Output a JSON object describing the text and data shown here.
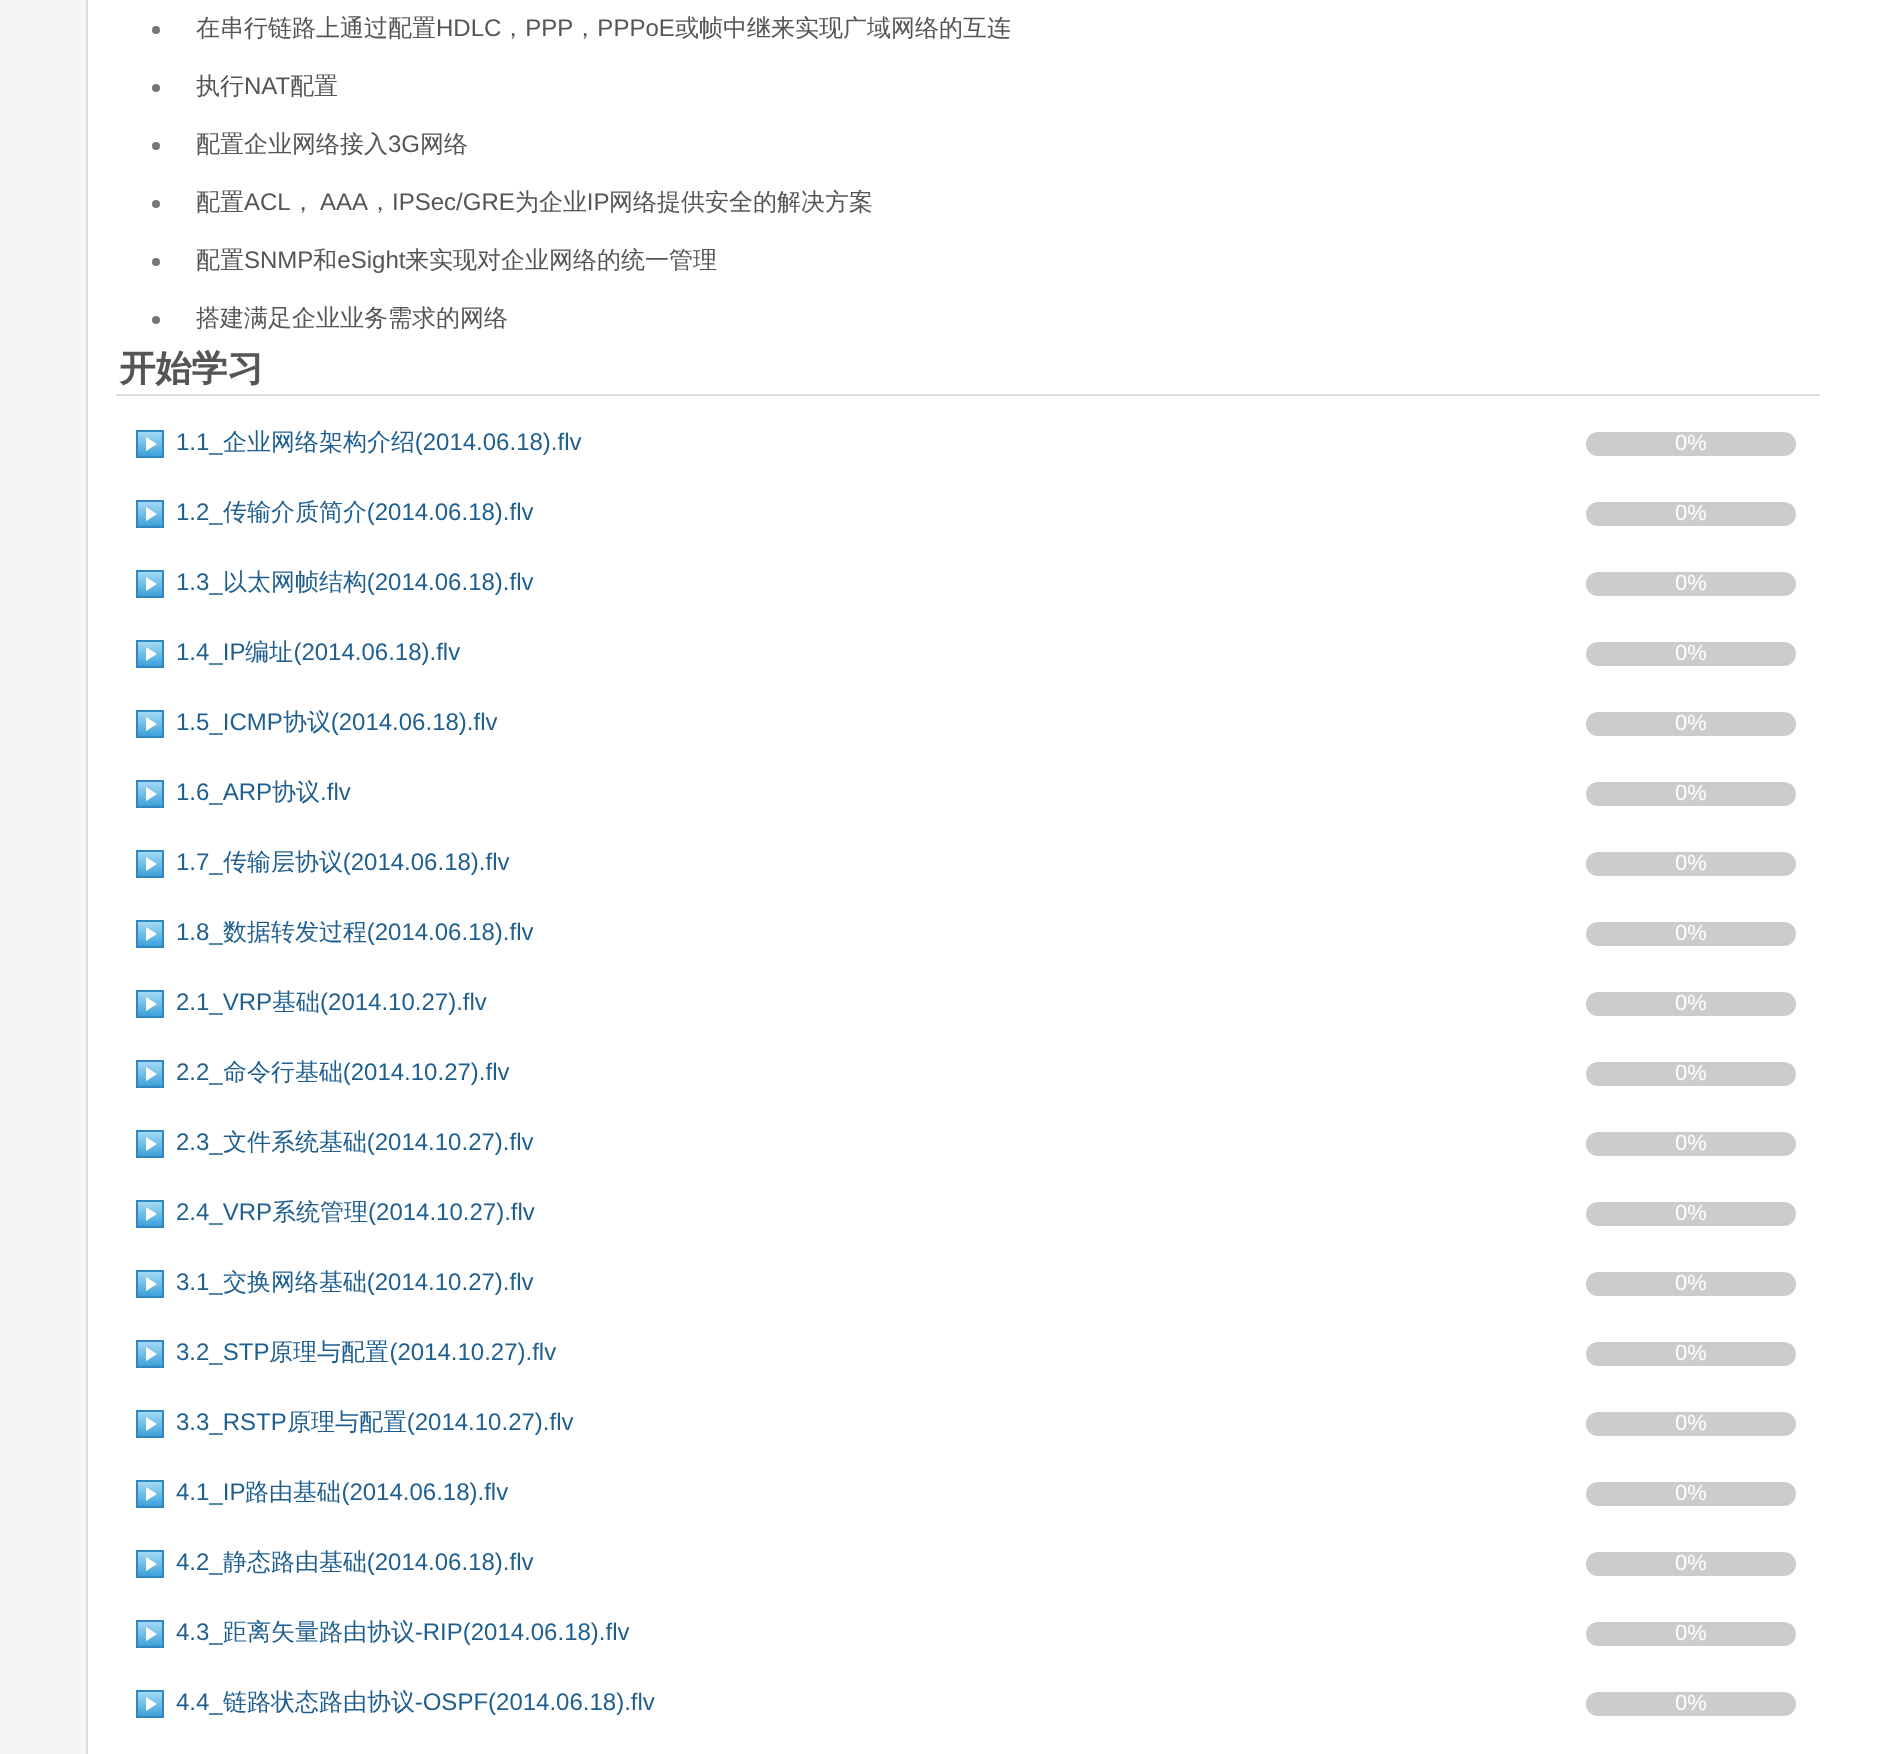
{
  "objectives": [
    "在串行链路上通过配置HDLC，PPP，PPPoE或帧中继来实现广域网络的互连",
    "执行NAT配置",
    "配置企业网络接入3G网络",
    "配置ACL， AAA，IPSec/GRE为企业IP网络提供安全的解决方案",
    "配置SNMP和eSight来实现对企业网络的统一管理",
    "搭建满足企业业务需求的网络"
  ],
  "section_title": "开始学习",
  "lessons": [
    {
      "title": "1.1_企业网络架构介绍(2014.06.18).flv",
      "level": 0,
      "progress": "0%"
    },
    {
      "title": "1.2_传输介质简介(2014.06.18).flv",
      "level": 0,
      "progress": "0%"
    },
    {
      "title": "1.3_以太网帧结构(2014.06.18).flv",
      "level": 0,
      "progress": "0%"
    },
    {
      "title": "1.4_IP编址(2014.06.18).flv",
      "level": 0,
      "progress": "0%"
    },
    {
      "title": "1.5_ICMP协议(2014.06.18).flv",
      "level": 0,
      "progress": "0%"
    },
    {
      "title": "1.6_ARP协议.flv",
      "level": 0,
      "progress": "0%"
    },
    {
      "title": "1.7_传输层协议(2014.06.18).flv",
      "level": 0,
      "progress": "0%"
    },
    {
      "title": "1.8_数据转发过程(2014.06.18).flv",
      "level": 0,
      "progress": "0%"
    },
    {
      "title": "2.1_VRP基础(2014.10.27).flv",
      "level": 0,
      "progress": "0%"
    },
    {
      "title": "2.2_命令行基础(2014.10.27).flv",
      "level": 0,
      "progress": "0%"
    },
    {
      "title": "2.3_文件系统基础(2014.10.27).flv",
      "level": 0,
      "progress": "0%"
    },
    {
      "title": "2.4_VRP系统管理(2014.10.27).flv",
      "level": 0,
      "progress": "0%"
    },
    {
      "title": "3.1_交换网络基础(2014.10.27).flv",
      "level": 0,
      "progress": "0%"
    },
    {
      "title": "3.2_STP原理与配置(2014.10.27).flv",
      "level": 0,
      "progress": "0%"
    },
    {
      "title": "3.3_RSTP原理与配置(2014.10.27).flv",
      "level": 0,
      "progress": "0%"
    },
    {
      "title": "4.1_IP路由基础(2014.06.18).flv",
      "level": 0,
      "progress": "0%"
    },
    {
      "title": "4.2_静态路由基础(2014.06.18).flv",
      "level": 0,
      "progress": "0%"
    },
    {
      "title": "4.3_距离矢量路由协议-RIP(2014.06.18).flv",
      "level": 0,
      "progress": "0%"
    },
    {
      "title": "4.4_链路状态路由协议-OSPF(2014.06.18).flv",
      "level": 0,
      "progress": "0%"
    }
  ]
}
